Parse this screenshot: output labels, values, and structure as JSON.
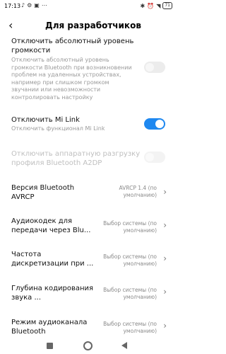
{
  "status": {
    "time": "17:13",
    "left_icons": [
      "♪",
      "⚙",
      "▣",
      "⋯"
    ],
    "right_icons": [
      "✱",
      "⏰",
      "◥"
    ],
    "battery": "71"
  },
  "header": {
    "title": "Для разработчиков",
    "back_icon": "back-arrow-icon"
  },
  "rows": [
    {
      "title": "Отключить абсолютный уровень громкости",
      "desc": "Отключить абсолютный уровень громкости Bluetooth при возникновении проблем на удаленных устройствах, например при слишком громком звучании или невозможности контролировать настройку",
      "toggle": "off",
      "enabled": false
    },
    {
      "title": "Отключить Mi Link",
      "desc": "Отключить функционал Mi Link",
      "toggle": "on"
    },
    {
      "title": "Отключить аппаратную разгрузку профиля Bluetooth A2DP",
      "toggle": "off",
      "disabled": true
    },
    {
      "title": "Версия Bluetooth AVRCP",
      "value": "AVRCP 1.4 (по умолчанию)"
    },
    {
      "title": "Аудиокодек для передачи через Blu...",
      "value": "Выбор системы (по умолчанию)"
    },
    {
      "title": "Частота дискретизации при ...",
      "value": "Выбор системы (по умолчанию)"
    },
    {
      "title": "Глубина кодирования звука ...",
      "value": "Выбор системы (по умолчанию)"
    },
    {
      "title": "Режим аудиоканала Bluetooth",
      "value": "Выбор системы (по умолчанию)"
    }
  ],
  "colors": {
    "accent": "#1e88f0",
    "toggle_off": "#ececec",
    "secondary_text": "#9a9a9a"
  }
}
